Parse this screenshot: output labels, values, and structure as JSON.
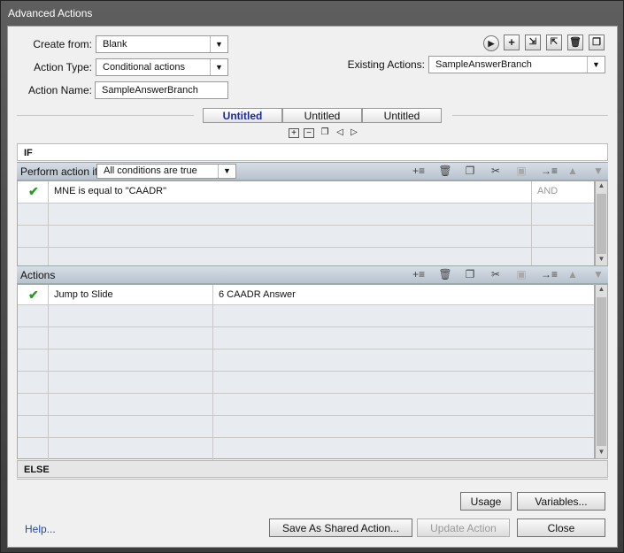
{
  "window": {
    "title": "Advanced Actions"
  },
  "form": {
    "create_from_label": "Create from:",
    "create_from_value": "Blank",
    "action_type_label": "Action Type:",
    "action_type_value": "Conditional actions",
    "action_name_label": "Action Name:",
    "action_name_value": "SampleAnswerBranch",
    "existing_actions_label": "Existing Actions:",
    "existing_actions_value": "SampleAnswerBranch"
  },
  "toolbar_icons": [
    "play-icon",
    "add-icon",
    "import-icon",
    "export-icon",
    "delete-icon",
    "duplicate-icon"
  ],
  "tabs": [
    {
      "label": "Untitled",
      "active": true
    },
    {
      "label": "Untitled",
      "active": false
    },
    {
      "label": "Untitled",
      "active": false
    }
  ],
  "if_section": {
    "header": "IF",
    "perform_label": "Perform action if:",
    "condition_mode": "All conditions are true",
    "conditions": [
      {
        "checked": true,
        "text": "MNE   is equal to    \"CAADR\"",
        "op": "AND"
      }
    ]
  },
  "actions_section": {
    "header": "Actions",
    "rows": [
      {
        "checked": true,
        "action": "Jump to Slide",
        "target": "6 CAADR Answer"
      }
    ]
  },
  "else_section": {
    "header": "ELSE"
  },
  "buttons": {
    "usage": "Usage",
    "variables": "Variables...",
    "save_shared": "Save As Shared Action...",
    "update": "Update Action",
    "close": "Close",
    "help": "Help..."
  }
}
